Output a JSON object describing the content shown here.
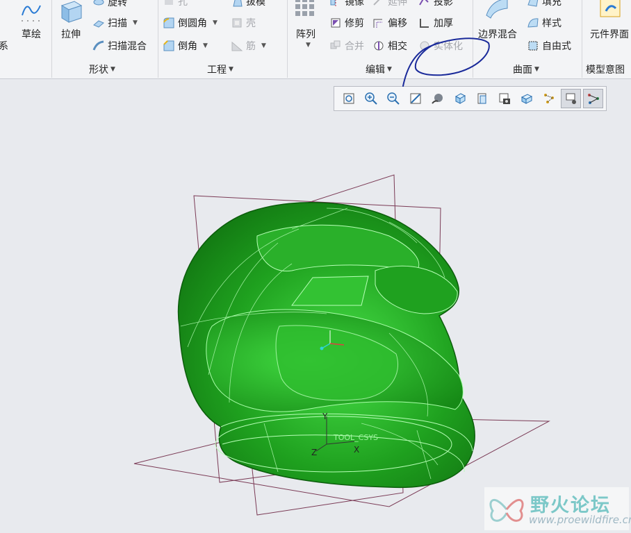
{
  "ribbon": {
    "datum": {
      "label_top": "系",
      "sketch": "草绘"
    },
    "shape": {
      "group": "形状",
      "extrude": "拉伸",
      "revolve": "旋转",
      "sweep": "扫描",
      "swept_blend": "扫描混合"
    },
    "engineering": {
      "group": "工程",
      "hole": "孔",
      "round": "倒圆角",
      "chamfer": "倒角",
      "draft": "拔模",
      "shell": "壳",
      "rib": "筋"
    },
    "editing": {
      "group": "编辑",
      "pattern": "阵列",
      "mirror": "镜像",
      "extend": "延伸",
      "project": "投影",
      "trim": "修剪",
      "offset": "偏移",
      "thicken": "加厚",
      "merge": "合并",
      "intersect": "相交",
      "solidify": "实体化"
    },
    "surfaces": {
      "group": "曲面",
      "boundary_blend": "边界混合",
      "fill": "填充",
      "style": "样式",
      "freestyle": "自由式"
    },
    "model_intent": {
      "group": "模型意图",
      "component_interface": "元件界面"
    }
  },
  "view_toolbar": {
    "icons": [
      "refit-icon",
      "zoom-in-icon",
      "zoom-out-icon",
      "repaint-icon",
      "display-style-icon",
      "saved-orientations-icon",
      "view-manager-icon",
      "perspective-icon",
      "spin-center-icon",
      "datum-display-icon",
      "annotation-display-icon",
      "named-view-icon"
    ]
  },
  "viewport": {
    "axis_labels": {
      "y": "Y",
      "x": "X",
      "z": "Z"
    },
    "csys_label": "TOOL_CSYS"
  },
  "watermark": {
    "title": "野火论坛",
    "url": "www.proewildfire.cn"
  },
  "colors": {
    "model_green": "#1fa11f",
    "datum_plane": "#7a3a55",
    "annotation_ink": "#1a2a9a"
  }
}
